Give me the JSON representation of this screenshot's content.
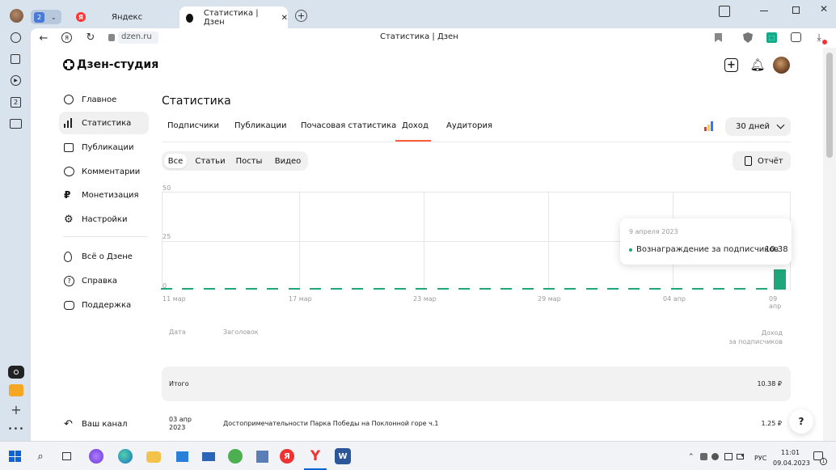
{
  "browser": {
    "profile_badge": "2",
    "tabs": [
      {
        "label": "Яндекс",
        "icon": "yandex-icon"
      },
      {
        "label": "Статистика | Дзен",
        "icon": "dzen-icon",
        "active": true
      }
    ],
    "address": "dzen.ru",
    "page_title": "Статистика | Дзен",
    "sidepanel_badge": "2"
  },
  "header": {
    "logo": "Дзен-студия"
  },
  "nav": {
    "items": [
      {
        "label": "Главное",
        "icon": "planet-icon"
      },
      {
        "label": "Статистика",
        "icon": "bar-chart-icon"
      },
      {
        "label": "Публикации",
        "icon": "stack-icon"
      },
      {
        "label": "Комментарии",
        "icon": "comment-icon"
      },
      {
        "label": "Монетизация",
        "icon": "ruble-icon"
      },
      {
        "label": "Настройки",
        "icon": "gear-icon"
      }
    ],
    "secondary": [
      {
        "label": "Всё о Дзене",
        "icon": "flame-icon"
      },
      {
        "label": "Справка",
        "icon": "question-icon"
      },
      {
        "label": "Поддержка",
        "icon": "chat-icon"
      }
    ],
    "channel": "Ваш канал"
  },
  "main": {
    "title": "Статистика",
    "tabs": [
      "Подписчики",
      "Публикации",
      "Почасовая статистика",
      "Доход",
      "Аудитория"
    ],
    "active_tab": "Доход",
    "period": "30 дней",
    "filters": [
      "Все",
      "Статьи",
      "Посты",
      "Видео"
    ],
    "active_filter": "Все",
    "report_label": "Отчёт"
  },
  "chart_data": {
    "type": "bar",
    "y_ticks": [
      "50",
      "25",
      "0"
    ],
    "ylim": [
      0,
      50
    ],
    "x_ticks": [
      "11 мар",
      "17 мар",
      "23 мар",
      "29 мар",
      "04 апр",
      "09 апр"
    ],
    "values": [
      0,
      0,
      0,
      0,
      0,
      0,
      0,
      0,
      0,
      0,
      0,
      0,
      0,
      0,
      0,
      0,
      0,
      0,
      0,
      0,
      0,
      0,
      0,
      0,
      0,
      0,
      0,
      0,
      0,
      10.38
    ],
    "accent": "#1fa67a",
    "tooltip": {
      "date": "9 апреля 2023",
      "series": "Вознаграждение за подписчиков",
      "value": "10.38"
    }
  },
  "table": {
    "headers": {
      "date": "Дата",
      "title": "Заголовок",
      "income_1": "Доход",
      "income_2": "за подписчиков"
    },
    "total": {
      "label": "Итого",
      "value": "10.38 ₽"
    },
    "rows": [
      {
        "date_1": "03 апр",
        "date_2": "2023",
        "title": "Достопримечательности Парка Победы на Поклонной горе ч.1",
        "value": "1.25 ₽"
      }
    ]
  },
  "help_button": "?",
  "taskbar": {
    "lang": "РУС",
    "time": "11:01",
    "date": "09.04.2023",
    "notif_count": "1"
  }
}
